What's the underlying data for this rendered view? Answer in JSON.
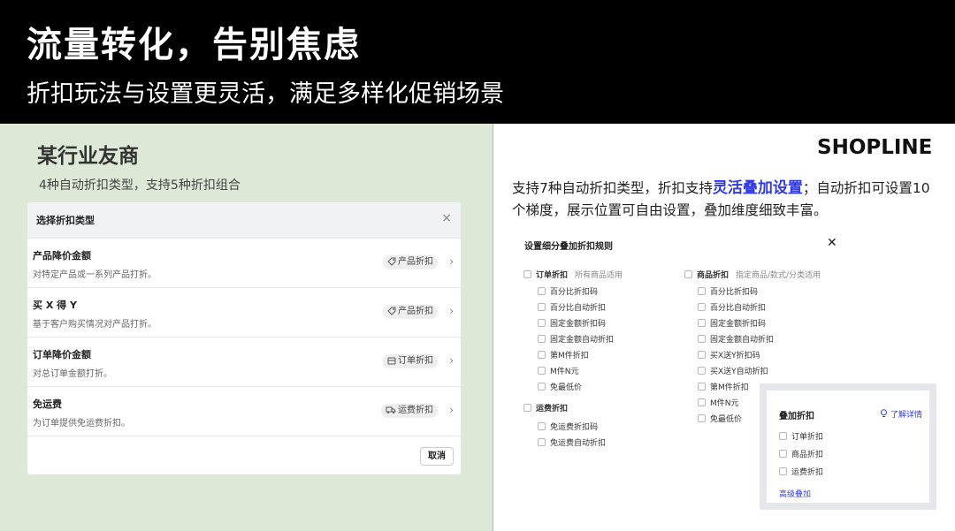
{
  "header": {
    "title": "流量转化，告别焦虑",
    "subtitle": "折扣玩法与设置更灵活，满足多样化促销场景"
  },
  "left": {
    "title": "某行业友商",
    "desc": "4种自动折扣类型，支持5种折扣组合",
    "dialog": {
      "title": "选择折扣类型",
      "close": "×",
      "rows": [
        {
          "title": "产品降价金额",
          "desc": "对特定产品或一系列产品打折。",
          "tag": "产品折扣",
          "tag_icon": "tag-icon"
        },
        {
          "title": "买 X 得 Y",
          "desc": "基于客户购买情况对产品打折。",
          "tag": "产品折扣",
          "tag_icon": "tag-icon"
        },
        {
          "title": "订单降价金额",
          "desc": "对总订单金额打折。",
          "tag": "订单折扣",
          "tag_icon": "cart-icon"
        },
        {
          "title": "免运费",
          "desc": "为订单提供免运费折扣。",
          "tag": "运费折扣",
          "tag_icon": "truck-icon"
        }
      ],
      "cancel": "取消"
    }
  },
  "right": {
    "logo": "SHOPLINE",
    "text_before": "支持7种自动折扣类型，折扣支持",
    "text_highlight": "灵活叠加设置",
    "text_after": "；自动折扣可设置10个梯度，展示位置可自由设置，叠加维度细致丰富。",
    "highlight_color": "#2f39e6",
    "panel": {
      "title": "设置细分叠加折扣规则",
      "close": "✕",
      "order": {
        "label": "订单折扣",
        "hint": "所有商品适用",
        "items": [
          "百分比折扣码",
          "百分比自动折扣",
          "固定金额折扣码",
          "固定金额自动折扣",
          "第M件折扣",
          "M件N元",
          "免最低价"
        ]
      },
      "shipping": {
        "label": "运费折扣",
        "items": [
          "免运费折扣码",
          "免运费自动折扣"
        ]
      },
      "product": {
        "label": "商品折扣",
        "hint": "指定商品/款式/分类适用",
        "items": [
          "百分比折扣码",
          "百分比自动折扣",
          "固定金额折扣码",
          "固定金额自动折扣",
          "买X送Y折扣码",
          "买X送Y自动折扣",
          "第M件折扣",
          "M件N元",
          "免最低价"
        ]
      }
    },
    "stack": {
      "title": "叠加折扣",
      "link": "了解详情",
      "items": [
        "订单折扣",
        "商品折扣",
        "运费折扣"
      ],
      "advanced": "高级叠加"
    }
  }
}
